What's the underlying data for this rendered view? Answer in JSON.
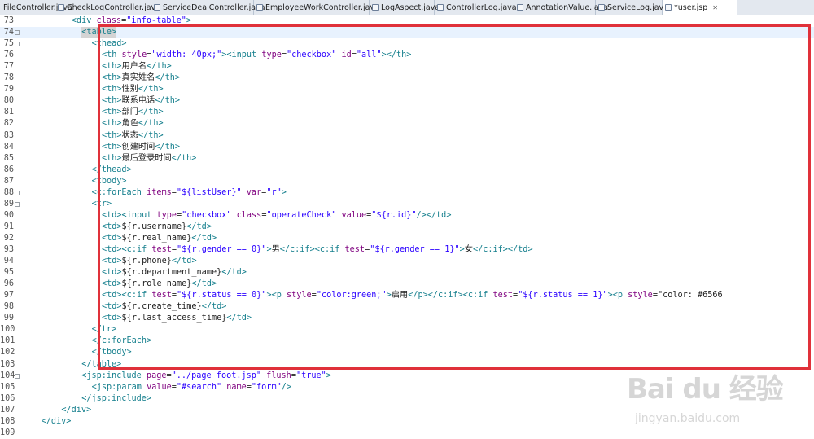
{
  "tabs": [
    {
      "label": "FileController.java",
      "icon": "java-file-icon",
      "active": false
    },
    {
      "label": "CheckLogController.java",
      "icon": "java-file-icon",
      "active": false
    },
    {
      "label": "ServiceDealController.java",
      "icon": "java-file-icon",
      "active": false
    },
    {
      "label": "EmployeeWorkController.java",
      "icon": "java-file-icon",
      "active": false
    },
    {
      "label": "LogAspect.java",
      "icon": "java-file-icon",
      "active": false
    },
    {
      "label": "ControllerLog.java",
      "icon": "java-file-icon",
      "active": false
    },
    {
      "label": "AnnotationValue.java",
      "icon": "java-file-icon",
      "active": false
    },
    {
      "label": "ServiceLog.java",
      "icon": "java-file-icon",
      "active": false
    },
    {
      "label": "*user.jsp",
      "icon": "jsp-file-icon",
      "active": true,
      "close": "✕"
    }
  ],
  "lines": [
    {
      "n": "73",
      "indent": 9,
      "fold": false,
      "current": false,
      "code": "<div class=\"info-table\">"
    },
    {
      "n": "74",
      "indent": 11,
      "fold": true,
      "current": true,
      "code": "<table>"
    },
    {
      "n": "75",
      "indent": 13,
      "fold": true,
      "current": false,
      "code": "<thead>"
    },
    {
      "n": "76",
      "indent": 15,
      "fold": false,
      "current": false,
      "code": "<th style=\"width: 40px;\"><input type=\"checkbox\" id=\"all\"></th>"
    },
    {
      "n": "77",
      "indent": 15,
      "fold": false,
      "current": false,
      "code": "<th>用户名</th>"
    },
    {
      "n": "78",
      "indent": 15,
      "fold": false,
      "current": false,
      "code": "<th>真实姓名</th>"
    },
    {
      "n": "79",
      "indent": 15,
      "fold": false,
      "current": false,
      "code": "<th>性别</th>"
    },
    {
      "n": "80",
      "indent": 15,
      "fold": false,
      "current": false,
      "code": "<th>联系电话</th>"
    },
    {
      "n": "81",
      "indent": 15,
      "fold": false,
      "current": false,
      "code": "<th>部门</th>"
    },
    {
      "n": "82",
      "indent": 15,
      "fold": false,
      "current": false,
      "code": "<th>角色</th>"
    },
    {
      "n": "83",
      "indent": 15,
      "fold": false,
      "current": false,
      "code": "<th>状态</th>"
    },
    {
      "n": "84",
      "indent": 15,
      "fold": false,
      "current": false,
      "code": "<th>创建时间</th>"
    },
    {
      "n": "85",
      "indent": 15,
      "fold": false,
      "current": false,
      "code": "<th>最后登录时间</th>"
    },
    {
      "n": "86",
      "indent": 13,
      "fold": false,
      "current": false,
      "code": "</thead>"
    },
    {
      "n": "87",
      "indent": 13,
      "fold": false,
      "current": false,
      "code": "<tbody>"
    },
    {
      "n": "88",
      "indent": 13,
      "fold": true,
      "current": false,
      "code": "<c:forEach items=\"${listUser}\" var=\"r\">"
    },
    {
      "n": "89",
      "indent": 13,
      "fold": true,
      "current": false,
      "code": "<tr>"
    },
    {
      "n": "90",
      "indent": 15,
      "fold": false,
      "current": false,
      "code": "<td><input type=\"checkbox\" class=\"operateCheck\" value=\"${r.id}\"/></td>"
    },
    {
      "n": "91",
      "indent": 15,
      "fold": false,
      "current": false,
      "code": "<td>${r.username}</td>"
    },
    {
      "n": "92",
      "indent": 15,
      "fold": false,
      "current": false,
      "code": "<td>${r.real_name}</td>"
    },
    {
      "n": "93",
      "indent": 15,
      "fold": false,
      "current": false,
      "code": "<td><c:if test=\"${r.gender == 0}\">男</c:if><c:if test=\"${r.gender == 1}\">女</c:if></td>"
    },
    {
      "n": "94",
      "indent": 15,
      "fold": false,
      "current": false,
      "code": "<td>${r.phone}</td>"
    },
    {
      "n": "95",
      "indent": 15,
      "fold": false,
      "current": false,
      "code": "<td>${r.department_name}</td>"
    },
    {
      "n": "96",
      "indent": 15,
      "fold": false,
      "current": false,
      "code": "<td>${r.role_name}</td>"
    },
    {
      "n": "97",
      "indent": 15,
      "fold": false,
      "current": false,
      "code": "<td><c:if test=\"${r.status == 0}\"><p style=\"color:green;\">启用</p></c:if><c:if test=\"${r.status == 1}\"><p style=\"color: #6566"
    },
    {
      "n": "98",
      "indent": 15,
      "fold": false,
      "current": false,
      "code": "<td>${r.create_time}</td>"
    },
    {
      "n": "99",
      "indent": 15,
      "fold": false,
      "current": false,
      "code": "<td>${r.last_access_time}</td>"
    },
    {
      "n": "100",
      "indent": 13,
      "fold": false,
      "current": false,
      "code": "</tr>"
    },
    {
      "n": "101",
      "indent": 13,
      "fold": false,
      "current": false,
      "code": "</c:forEach>"
    },
    {
      "n": "102",
      "indent": 13,
      "fold": false,
      "current": false,
      "code": "</tbody>"
    },
    {
      "n": "103",
      "indent": 11,
      "fold": false,
      "current": false,
      "code": "</table>"
    },
    {
      "n": "104",
      "indent": 11,
      "fold": true,
      "current": false,
      "code": "<jsp:include page=\"../page_foot.jsp\" flush=\"true\">"
    },
    {
      "n": "105",
      "indent": 13,
      "fold": false,
      "current": false,
      "code": "<jsp:param value=\"#search\" name=\"form\"/>"
    },
    {
      "n": "106",
      "indent": 11,
      "fold": false,
      "current": false,
      "code": "</jsp:include>"
    },
    {
      "n": "107",
      "indent": 7,
      "fold": false,
      "current": false,
      "code": "</div>"
    },
    {
      "n": "108",
      "indent": 3,
      "fold": false,
      "current": false,
      "code": "</div>"
    },
    {
      "n": "109",
      "indent": 0,
      "fold": false,
      "current": false,
      "code": ""
    }
  ],
  "watermark": {
    "logo": "Bai du 经验",
    "sub": "jingyan.baidu.com"
  },
  "colors": {
    "highlight_box": "#e0313a",
    "tag": "#17808e",
    "attribute": "#7f007f",
    "string": "#2a00ff"
  }
}
